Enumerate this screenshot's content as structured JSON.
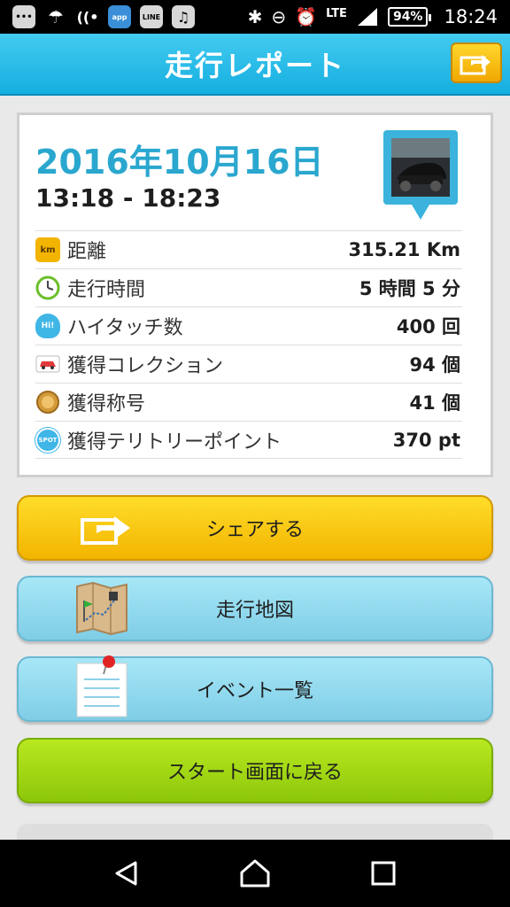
{
  "status_bar": {
    "lte": "LTE",
    "battery": "94%",
    "time": "18:24",
    "icons": [
      "message-icon",
      "weather-icon",
      "wifi-calling-icon",
      "app-notification-icon",
      "line-icon",
      "music-icon",
      "bluetooth-icon",
      "do-not-disturb-icon",
      "alarm-icon",
      "signal-icon"
    ]
  },
  "header": {
    "title": "走行レポート"
  },
  "report": {
    "date": "2016年10月16日",
    "time_range": "13:18 - 18:23",
    "stats": [
      {
        "icon": "km-icon",
        "icon_text": "km",
        "label": "距離",
        "value": "315.21 Km"
      },
      {
        "icon": "clock-icon",
        "label": "走行時間",
        "value": "5 時間 5 分"
      },
      {
        "icon": "hi-touch-icon",
        "icon_text": "Hi!",
        "label": "ハイタッチ数",
        "value": "400 回"
      },
      {
        "icon": "car-collection-icon",
        "label": "獲得コレクション",
        "value": "94 個"
      },
      {
        "icon": "title-medal-icon",
        "label": "獲得称号",
        "value": "41 個"
      },
      {
        "icon": "spot-icon",
        "icon_text": "SPOT",
        "label": "獲得テリトリーポイント",
        "value": "370 pt"
      }
    ]
  },
  "buttons": {
    "share": "シェアする",
    "map": "走行地図",
    "events": "イベント一覧",
    "back_to_start": "スタート画面に戻る"
  },
  "colors": {
    "header": "#1bb3e3",
    "date_text": "#2aa7cf",
    "share_button": "#f7c300",
    "info_buttons": "#8fd6ec",
    "start_button": "#a3d614"
  }
}
